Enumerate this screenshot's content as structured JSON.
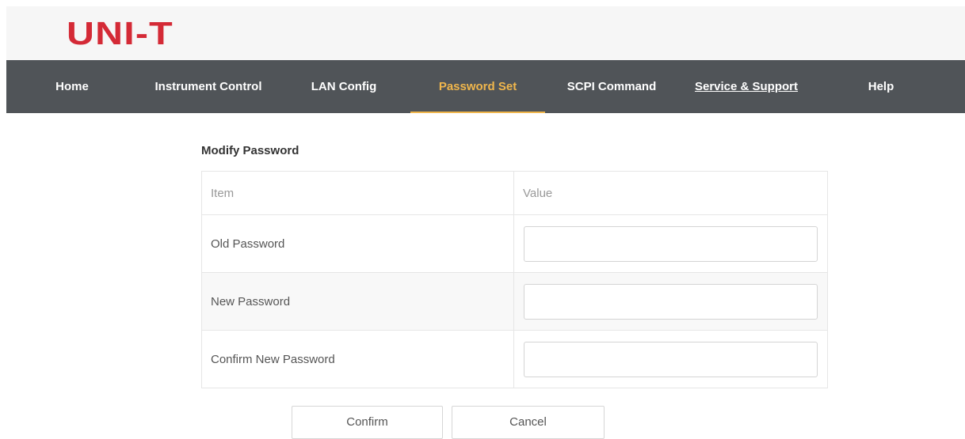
{
  "logo": {
    "text": "UNI-T",
    "color": "#d42a36"
  },
  "nav": {
    "items": [
      {
        "label": "Home"
      },
      {
        "label": "Instrument Control"
      },
      {
        "label": "LAN Config"
      },
      {
        "label": "Password Set",
        "active": true
      },
      {
        "label": "SCPI Command"
      },
      {
        "label": "Service & Support"
      },
      {
        "label": "Help"
      }
    ],
    "background_color": "#505458",
    "active_color": "#f0b64c"
  },
  "form": {
    "title": "Modify Password",
    "columns": [
      "Item",
      "Value"
    ],
    "rows": [
      {
        "label": "Old Password",
        "value": ""
      },
      {
        "label": "New Password",
        "value": ""
      },
      {
        "label": "Confirm New Password",
        "value": ""
      }
    ]
  },
  "buttons": {
    "confirm": "Confirm",
    "cancel": "Cancel"
  }
}
